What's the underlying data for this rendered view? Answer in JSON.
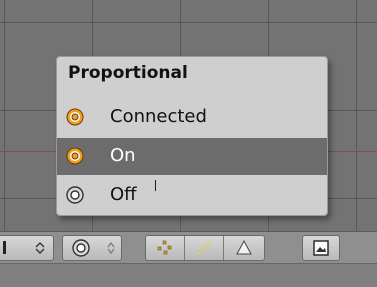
{
  "menu": {
    "title": "Proportional",
    "items": [
      {
        "label": "Connected",
        "icon": "proportional-connected-icon",
        "selected": false
      },
      {
        "label": "On",
        "icon": "proportional-on-icon",
        "selected": true
      },
      {
        "label": "Off",
        "icon": "proportional-off-icon",
        "selected": false
      }
    ]
  },
  "colors": {
    "accent_orange": "#f0a020",
    "selection_gray": "#6c6c6c",
    "menu_bg": "#cfcfcf"
  }
}
